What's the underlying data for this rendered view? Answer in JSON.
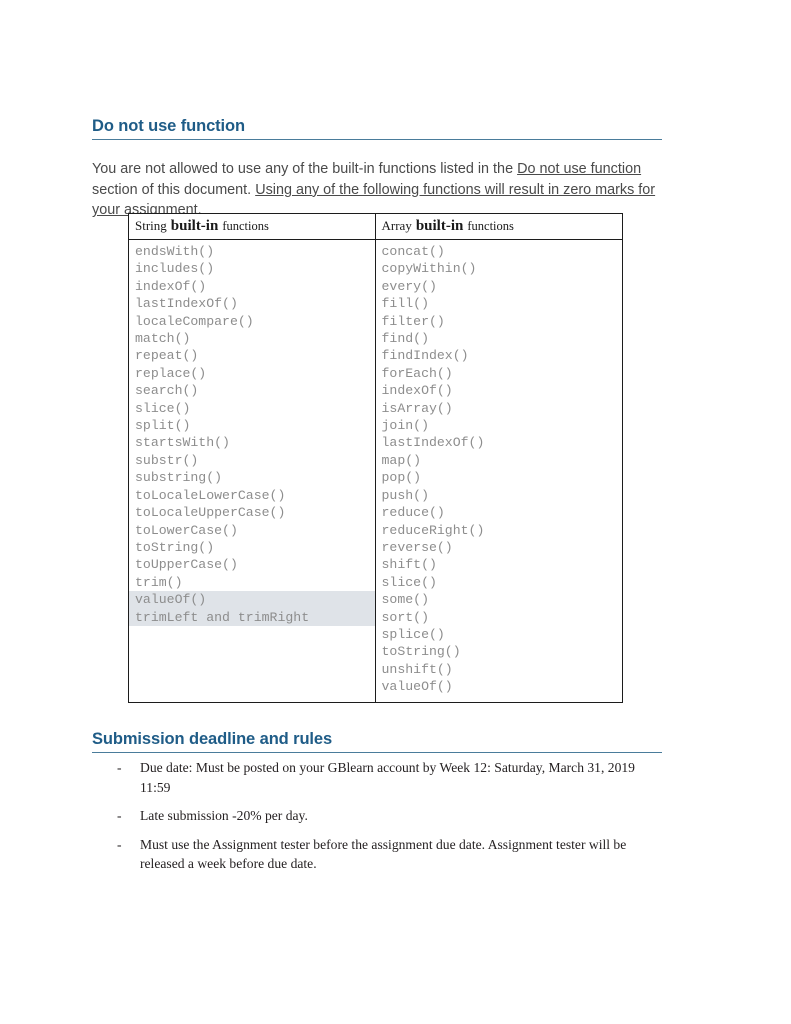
{
  "document": {
    "sections": [
      {
        "id": "do-not-use",
        "heading": "Do not use function"
      },
      {
        "id": "submission",
        "heading": "Submission deadline and rules"
      }
    ]
  },
  "intro": {
    "part1": "You are not allowed to use any of the built-in functions listed in the ",
    "link1": "Do not use function",
    "part2": " section of this document. ",
    "link2": "Using any of the following functions will result in zero marks for your assignment."
  },
  "table": {
    "columns": [
      {
        "header_pre": "String",
        "header_bold": "built-in",
        "header_post": "functions",
        "items": [
          {
            "text": "endsWith()",
            "highlighted": false
          },
          {
            "text": "includes()",
            "highlighted": false
          },
          {
            "text": "indexOf()",
            "highlighted": false
          },
          {
            "text": "lastIndexOf()",
            "highlighted": false
          },
          {
            "text": "localeCompare()",
            "highlighted": false
          },
          {
            "text": "match()",
            "highlighted": false
          },
          {
            "text": "repeat()",
            "highlighted": false
          },
          {
            "text": "replace()",
            "highlighted": false
          },
          {
            "text": "search()",
            "highlighted": false
          },
          {
            "text": "slice()",
            "highlighted": false
          },
          {
            "text": "split()",
            "highlighted": false
          },
          {
            "text": "startsWith()",
            "highlighted": false
          },
          {
            "text": "substr()",
            "highlighted": false
          },
          {
            "text": "substring()",
            "highlighted": false
          },
          {
            "text": "toLocaleLowerCase()",
            "highlighted": false
          },
          {
            "text": "toLocaleUpperCase()",
            "highlighted": false
          },
          {
            "text": "toLowerCase()",
            "highlighted": false
          },
          {
            "text": "toString()",
            "highlighted": false
          },
          {
            "text": "toUpperCase()",
            "highlighted": false
          },
          {
            "text": "trim()",
            "highlighted": false
          },
          {
            "text": "valueOf()",
            "highlighted": true
          },
          {
            "text": "trimLeft and trimRight",
            "highlighted": true
          }
        ]
      },
      {
        "header_pre": "Array",
        "header_bold": "built-in",
        "header_post": "functions",
        "items": [
          {
            "text": "concat()",
            "highlighted": false
          },
          {
            "text": "copyWithin()",
            "highlighted": false
          },
          {
            "text": "every()",
            "highlighted": false
          },
          {
            "text": "fill()",
            "highlighted": false
          },
          {
            "text": "filter()",
            "highlighted": false
          },
          {
            "text": "find()",
            "highlighted": false
          },
          {
            "text": "findIndex()",
            "highlighted": false
          },
          {
            "text": "forEach()",
            "highlighted": false
          },
          {
            "text": "indexOf()",
            "highlighted": false
          },
          {
            "text": "isArray()",
            "highlighted": false
          },
          {
            "text": "join()",
            "highlighted": false
          },
          {
            "text": "lastIndexOf()",
            "highlighted": false
          },
          {
            "text": "map()",
            "highlighted": false
          },
          {
            "text": "pop()",
            "highlighted": false
          },
          {
            "text": "push()",
            "highlighted": false
          },
          {
            "text": "reduce()",
            "highlighted": false
          },
          {
            "text": "reduceRight()",
            "highlighted": false
          },
          {
            "text": "reverse()",
            "highlighted": false
          },
          {
            "text": "shift()",
            "highlighted": false
          },
          {
            "text": "slice()",
            "highlighted": false
          },
          {
            "text": "some()",
            "highlighted": false
          },
          {
            "text": "sort()",
            "highlighted": false
          },
          {
            "text": "splice()",
            "highlighted": false
          },
          {
            "text": "toString()",
            "highlighted": false
          },
          {
            "text": "unshift()",
            "highlighted": false
          },
          {
            "text": "valueOf()",
            "highlighted": false
          }
        ]
      }
    ]
  },
  "rules": {
    "bullet_marker": "-",
    "items": [
      "Due date: Must be posted on your GBlearn account by Week 12: Saturday, March 31, 2019 11:59",
      "Late submission -20% per day.",
      "Must use the Assignment tester before the assignment due date. Assignment tester will be released a week before due date."
    ]
  },
  "colors": {
    "heading": "#1f5c87",
    "heading_rule": "#4a7c9b",
    "body_text": "#4a4a4a",
    "code_text": "#8d8d8d",
    "highlight": "#dfe3e8",
    "table_border": "#1c1c1c",
    "serif_text": "#231f20"
  }
}
